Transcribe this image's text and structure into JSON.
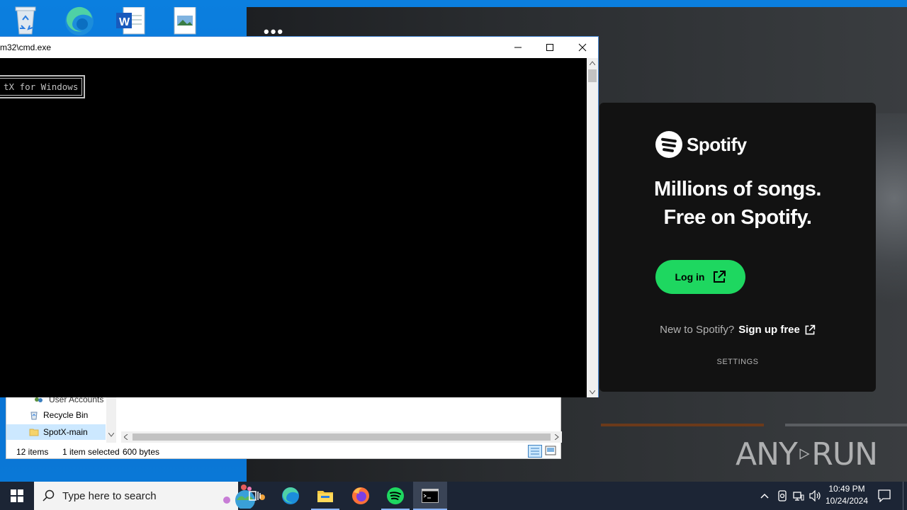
{
  "cmd": {
    "title": "m32\\cmd.exe",
    "console_box_text": "tX for Windows",
    "minimize": "—",
    "maximize": "☐",
    "close": "✕"
  },
  "spotify": {
    "logo_text": "Spotify",
    "headline_1": "Millions of songs.",
    "headline_2": "Free on Spotify.",
    "login_label": "Log in",
    "new_prompt": "New to Spotify?",
    "signup_label": "Sign up free",
    "settings_label": "SETTINGS",
    "accent": "#1ed760"
  },
  "explorer": {
    "nav_items": [
      {
        "label": "User Accounts"
      },
      {
        "label": "Recycle Bin"
      },
      {
        "label": "SpotX-main"
      }
    ],
    "status": {
      "count": "12 items",
      "selected": "1 item selected",
      "size": "600 bytes"
    }
  },
  "taskbar": {
    "search_placeholder": "Type here to search",
    "time": "10:49 PM",
    "date": "10/24/2024"
  },
  "watermark": {
    "text_left": "ANY",
    "text_right": "RUN"
  }
}
